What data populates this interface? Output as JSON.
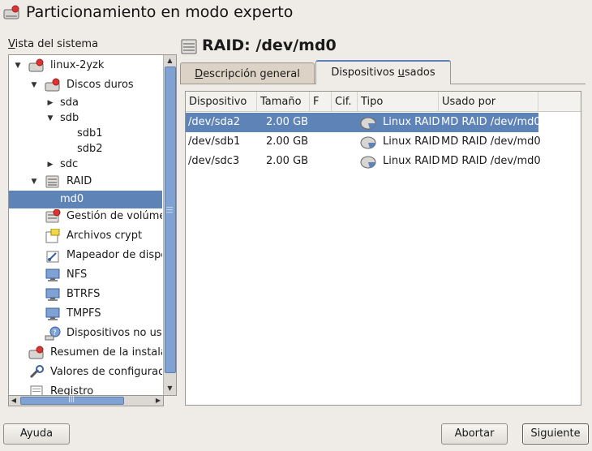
{
  "window": {
    "title": "Particionamiento en modo experto"
  },
  "tree": {
    "label": "Vista del sistema",
    "items": [
      {
        "label": "linux-2yzk",
        "icon": "harddisk-system-icon",
        "expander": "▼"
      },
      {
        "label": "Discos duros",
        "icon": "harddisk-icon",
        "expander": "▼"
      },
      {
        "label": "sda",
        "expander": "▶"
      },
      {
        "label": "sdb",
        "expander": "▼"
      },
      {
        "label": "sdb1"
      },
      {
        "label": "sdb2"
      },
      {
        "label": "sdc",
        "expander": "▶"
      },
      {
        "label": "RAID",
        "icon": "raid-icon",
        "expander": "▼"
      },
      {
        "label": "md0",
        "selected": true
      },
      {
        "label": "Gestión de volúmenes",
        "icon": "volume-management-icon"
      },
      {
        "label": "Archivos crypt",
        "icon": "crypt-files-icon"
      },
      {
        "label": "Mapeador de dispositivos",
        "icon": "device-mapper-icon"
      },
      {
        "label": "NFS",
        "icon": "network-drive-icon"
      },
      {
        "label": "BTRFS",
        "icon": "network-drive-icon"
      },
      {
        "label": "TMPFS",
        "icon": "network-drive-icon"
      },
      {
        "label": "Dispositivos no usados",
        "icon": "unused-devices-icon"
      },
      {
        "label": "Resumen de la instalación",
        "icon": "harddisk-icon"
      },
      {
        "label": "Valores de configuración",
        "icon": "settings-tools-icon"
      },
      {
        "label": "Registro",
        "icon": "log-icon"
      }
    ]
  },
  "main": {
    "title": "RAID: /dev/md0",
    "tabs": [
      {
        "label": "Descripción general",
        "active": false
      },
      {
        "label": "Dispositivos usados",
        "active": true
      }
    ],
    "table": {
      "columns": [
        "Dispositivo",
        "Tamaño",
        "F",
        "Cif.",
        "Tipo",
        "Usado por"
      ],
      "rows": [
        {
          "device": "/dev/sda2",
          "size": "2.00 GB",
          "type": "Linux RAID",
          "used_by": "MD RAID /dev/md0",
          "selected": true
        },
        {
          "device": "/dev/sdb1",
          "size": "2.00 GB",
          "type": "Linux RAID",
          "used_by": "MD RAID /dev/md0",
          "selected": false
        },
        {
          "device": "/dev/sdc3",
          "size": "2.00 GB",
          "type": "Linux RAID",
          "used_by": "MD RAID /dev/md0",
          "selected": false
        }
      ]
    }
  },
  "buttons": {
    "help": "Ayuda",
    "abort": "Abortar",
    "next": "Siguiente"
  },
  "colors": {
    "selection": "#5e83b7",
    "window_bg": "#efebe7"
  }
}
